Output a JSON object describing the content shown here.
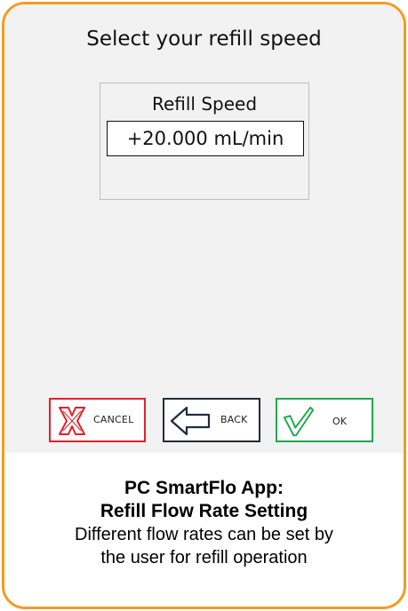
{
  "screen": {
    "title": "Select your refill speed",
    "refill_speed": {
      "label": "Refill Speed",
      "value": "+20.000 mL/min"
    },
    "buttons": {
      "cancel": "CANCEL",
      "back": "BACK",
      "ok": "OK"
    }
  },
  "caption": {
    "line1": "PC SmartFlo App:",
    "line2": "Refill Flow Rate Setting",
    "line3": "Different flow rates can be set by",
    "line4": "the user for refill operation"
  },
  "colors": {
    "frame": "#f39c1f",
    "cancel": "#e2202a",
    "back": "#1f2d3a",
    "ok": "#1aa84a"
  }
}
